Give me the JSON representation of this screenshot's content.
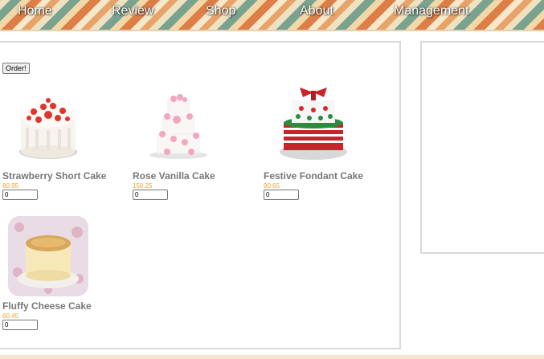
{
  "nav": {
    "items": [
      {
        "label": "Home"
      },
      {
        "label": "Review"
      },
      {
        "label": "Shop"
      },
      {
        "label": "About"
      },
      {
        "label": "Management"
      }
    ]
  },
  "shop": {
    "order_label": "Order!",
    "products": [
      {
        "name": "Strawberry Short Cake",
        "price": "80.95",
        "quantity": "0",
        "image_icon": "strawberry-cake-image"
      },
      {
        "name": "Rose Vanilla Cake",
        "price": "150.25",
        "quantity": "0",
        "image_icon": "rose-cake-image"
      },
      {
        "name": "Festive Fondant Cake",
        "price": "90.65",
        "quantity": "0",
        "image_icon": "fondant-cake-image"
      },
      {
        "name": "Fluffy Cheese Cake",
        "price": "60.45",
        "quantity": "0",
        "image_icon": "cheese-cake-image"
      }
    ]
  },
  "colors": {
    "price": "#f0a030",
    "product_name": "#777777",
    "panel_border": "#d9d9d9"
  }
}
